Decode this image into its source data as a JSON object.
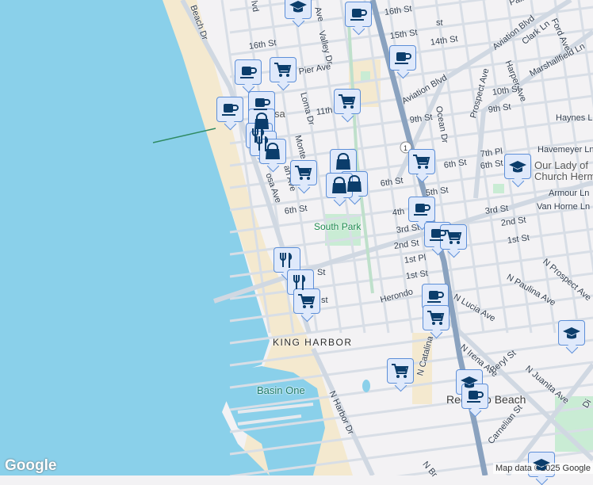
{
  "map": {
    "colors": {
      "water": "#8ad0ea",
      "sand": "#f4e9cf",
      "land": "#f3f2f4",
      "road": "#d4dbe4",
      "highway": "#8aa2bf",
      "park": "#c9ecd4",
      "marker_fill": "#dfe9fb",
      "marker_border": "#5d8fd8",
      "marker_icon": "#0b3d6b"
    },
    "labels": {
      "beach_dr": "Beach Dr",
      "blvd": "lvd",
      "sixteenth_w": "16th St",
      "pier": "Pier Ave",
      "loma": "Loma Dr",
      "valley": "Valley Dr",
      "ave_top": "Ave",
      "sixteenth_e": "16th St",
      "fifteenth": "15th St",
      "fourteenth": "14th St",
      "palm": "Palm",
      "aviation1": "Aviation Blvd",
      "aviation2": "Aviation Blvd",
      "clark": "Clark Ln",
      "ford": "Ford Ave",
      "harper": "Harper Ave",
      "marshallfield": "Marshallfield Ln",
      "prospect": "Prospect Ave",
      "tenth": "10th St",
      "ninth_e": "9th St",
      "ninth": "9th St",
      "haynes": "Haynes Ln",
      "eleventh": "11th",
      "ocean": "Ocean Dr",
      "hermosa": "sa",
      "monte": "Monte",
      "an_ave": "an Ave",
      "rosa": "osa Ave",
      "sixth_w": "6th St",
      "sixth_m": "6th St",
      "sixth_e": "6th St",
      "seventh_pl": "7th Pl",
      "sixth_e2": "6th St",
      "havemeyer": "Havemeyer Ln",
      "fifth": "5th St",
      "armour": "Armour Ln",
      "van_horne": "Van Horne Ln",
      "fourth": "4th",
      "third": "3rd St",
      "third_e": "3rd St",
      "second": "2nd St",
      "second_e": "2nd St",
      "first_pl": "1st Pl",
      "first": "1st St",
      "first_e": "1st St",
      "va": "Va",
      "herondo": "Herondo",
      "n_prospect": "N Prospect Ave",
      "n_paulina": "N Paulina Ave",
      "n_lucia": "N Lucia Ave",
      "n_irena": "N Irena Ave",
      "beryl": "Beryl St",
      "n_juanita": "N Juanita Ave",
      "n_catalina": "N Catalina",
      "carnelian": "Carnelian St",
      "n_harbor": "N Harbor Dr",
      "n_b": "N Br",
      "st1": "St",
      "st2": "st",
      "st3": "st",
      "di": "Di",
      "route": "1"
    },
    "places": {
      "south_park": "South Park",
      "king_harbor": "KING HARBOR",
      "basin_one": "Basin One",
      "redondo_beach": "Redondo Beach",
      "our_lady": "Our Lady of",
      "church": "Church Herm"
    },
    "markers": [
      "school",
      "coffee",
      "coffee",
      "coffee",
      "shopping-cart",
      "shopping-cart",
      "coffee",
      "coffee",
      "shopping-bag",
      "restaurant",
      "restaurant",
      "shopping-bag",
      "shopping-cart",
      "shopping-bag",
      "shopping-bag",
      "shopping-bag",
      "shopping-cart",
      "school",
      "coffee",
      "coffee",
      "shopping-cart",
      "restaurant",
      "restaurant",
      "shopping-cart",
      "coffee",
      "shopping-cart",
      "school",
      "shopping-cart",
      "school",
      "coffee",
      "school"
    ]
  },
  "branding": {
    "logo": "Google",
    "attribution": "Map data ©2025 Google"
  }
}
